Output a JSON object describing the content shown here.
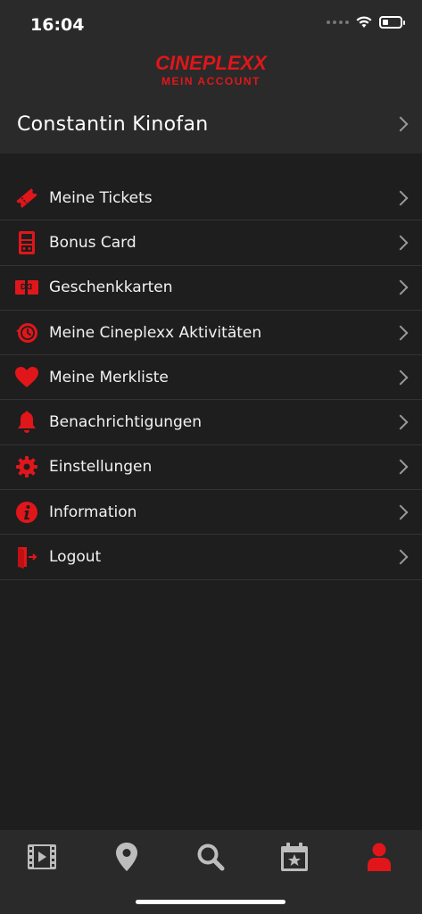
{
  "status_bar": {
    "time": "16:04"
  },
  "header": {
    "brand": "CINEPLEXX",
    "subtitle": "MEIN ACCOUNT"
  },
  "profile": {
    "name": "Constantin Kinofan"
  },
  "menu": {
    "items": [
      {
        "label": "Meine Tickets",
        "icon": "ticket-icon"
      },
      {
        "label": "Bonus Card",
        "icon": "bonus-card-icon"
      },
      {
        "label": "Geschenkkarten",
        "icon": "gift-card-icon"
      },
      {
        "label": "Meine Cineplexx Aktivitäten",
        "icon": "history-icon"
      },
      {
        "label": "Meine Merkliste",
        "icon": "heart-icon"
      },
      {
        "label": "Benachrichtigungen",
        "icon": "bell-icon"
      },
      {
        "label": "Einstellungen",
        "icon": "gear-icon"
      },
      {
        "label": "Information",
        "icon": "info-icon"
      },
      {
        "label": "Logout",
        "icon": "logout-icon"
      }
    ]
  },
  "tab_bar": {
    "tabs": [
      {
        "icon": "film-icon",
        "active": false
      },
      {
        "icon": "location-pin-icon",
        "active": false
      },
      {
        "icon": "search-icon",
        "active": false
      },
      {
        "icon": "calendar-star-icon",
        "active": false
      },
      {
        "icon": "account-icon",
        "active": true
      }
    ]
  },
  "colors": {
    "accent": "#e0161b",
    "background": "#1e1e1e",
    "panel": "#2a2a2a",
    "tab_inactive": "#bdbdbd"
  }
}
